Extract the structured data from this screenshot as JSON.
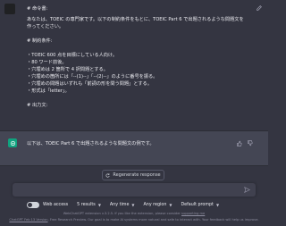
{
  "user_message": {
    "lines": [
      "# 命令書:",
      "あなたは、TOEIC の専門家です。以下の制約条件をもとに、TOEIC Part 6 で出題されるような問題文を",
      "作ってください。",
      "",
      "# 制約条件:",
      "",
      "・TOEIC 600 点を目標にしている人向け。",
      "・80 ワード前後。",
      "・穴埋めは 2 箇所で 4 択問題とする。",
      "・穴埋めの箇所には「--(1)--」「--(2)--」のように番号を振る。",
      "・穴埋めの問題はいずれも「前詞の形を問う問題」とする。",
      "・形式は「letter」。",
      "",
      "# 出力文:"
    ]
  },
  "assistant_message": {
    "text": "以下は、TOEIC Part 6 で出題されるような問題文の例です。"
  },
  "regenerate": {
    "label": "Regenerate response"
  },
  "input": {
    "placeholder": ""
  },
  "toolbar": {
    "web_access": "Web access",
    "results": "5 results",
    "time": "Any time",
    "region": "Any region",
    "prompt": "Default prompt"
  },
  "footer": {
    "line1_pre": "WebChatGPT extension v.3.2.5. If you like the extension, please consider ",
    "line1_link": "supporting me",
    "line2_link": "ChatGPT Feb 13 Version",
    "line2_post": ". Free Research Preview. Our goal is to make AI systems more natural and safe to interact with. Your feedback will help us improve."
  },
  "colors": {
    "background": "#343541",
    "assistant_bg": "#444654",
    "accent": "#10a37f"
  }
}
